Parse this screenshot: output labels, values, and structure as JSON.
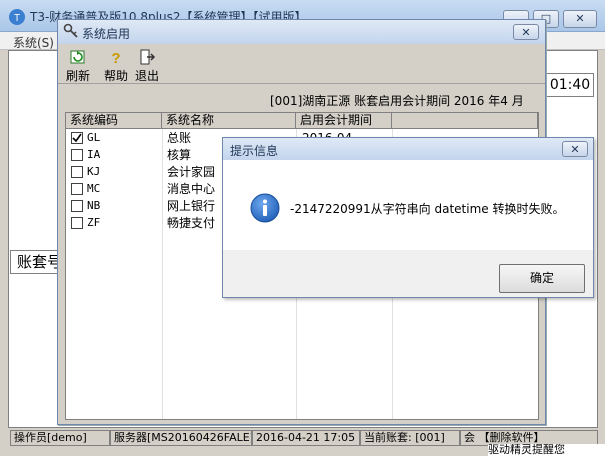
{
  "main_window": {
    "title": "T3-财务通普及版10.8plus2【系统管理】【试用版】",
    "menu": [
      "系统(S)"
    ],
    "clock": "01:40",
    "account_label": "账套号",
    "status": {
      "operator": "操作员[demo]",
      "server": "服务器[MS20160426FALE]",
      "datetime": "2016-04-21 17:05",
      "current_account": "当前账套: [001]",
      "software_label": "会 【删除软件】"
    },
    "bottom_notice": "驱动精灵提醒您"
  },
  "system_dialog": {
    "title": "系统启用",
    "toolbar": [
      {
        "label": "刷新",
        "icon": "refresh-icon"
      },
      {
        "label": "帮助",
        "icon": "help-icon"
      },
      {
        "label": "退出",
        "icon": "exit-icon"
      }
    ],
    "period_text": "[001]湖南正源 账套启用会计期间 2016 年4 月",
    "columns": [
      "系统编码",
      "系统名称",
      "启用会计期间"
    ],
    "rows": [
      {
        "code": "GL",
        "name": "总账",
        "period": "2016-04",
        "checked": true
      },
      {
        "code": "IA",
        "name": "核算",
        "period": "",
        "checked": false
      },
      {
        "code": "KJ",
        "name": "会计家园",
        "period": "",
        "checked": false
      },
      {
        "code": "MC",
        "name": "消息中心",
        "period": "",
        "checked": false
      },
      {
        "code": "NB",
        "name": "网上银行",
        "period": "",
        "checked": false
      },
      {
        "code": "ZF",
        "name": "畅捷支付",
        "period": "",
        "checked": false
      }
    ]
  },
  "message_dialog": {
    "title": "提示信息",
    "icon": "info-icon",
    "message": "-2147220991从字符串向 datetime 转换时失败。",
    "ok_label": "确定"
  },
  "colors": {
    "titlebar": "#c3d4ec",
    "window_bg": "#d4d0c8",
    "info_blue": "#1f5fb8"
  }
}
